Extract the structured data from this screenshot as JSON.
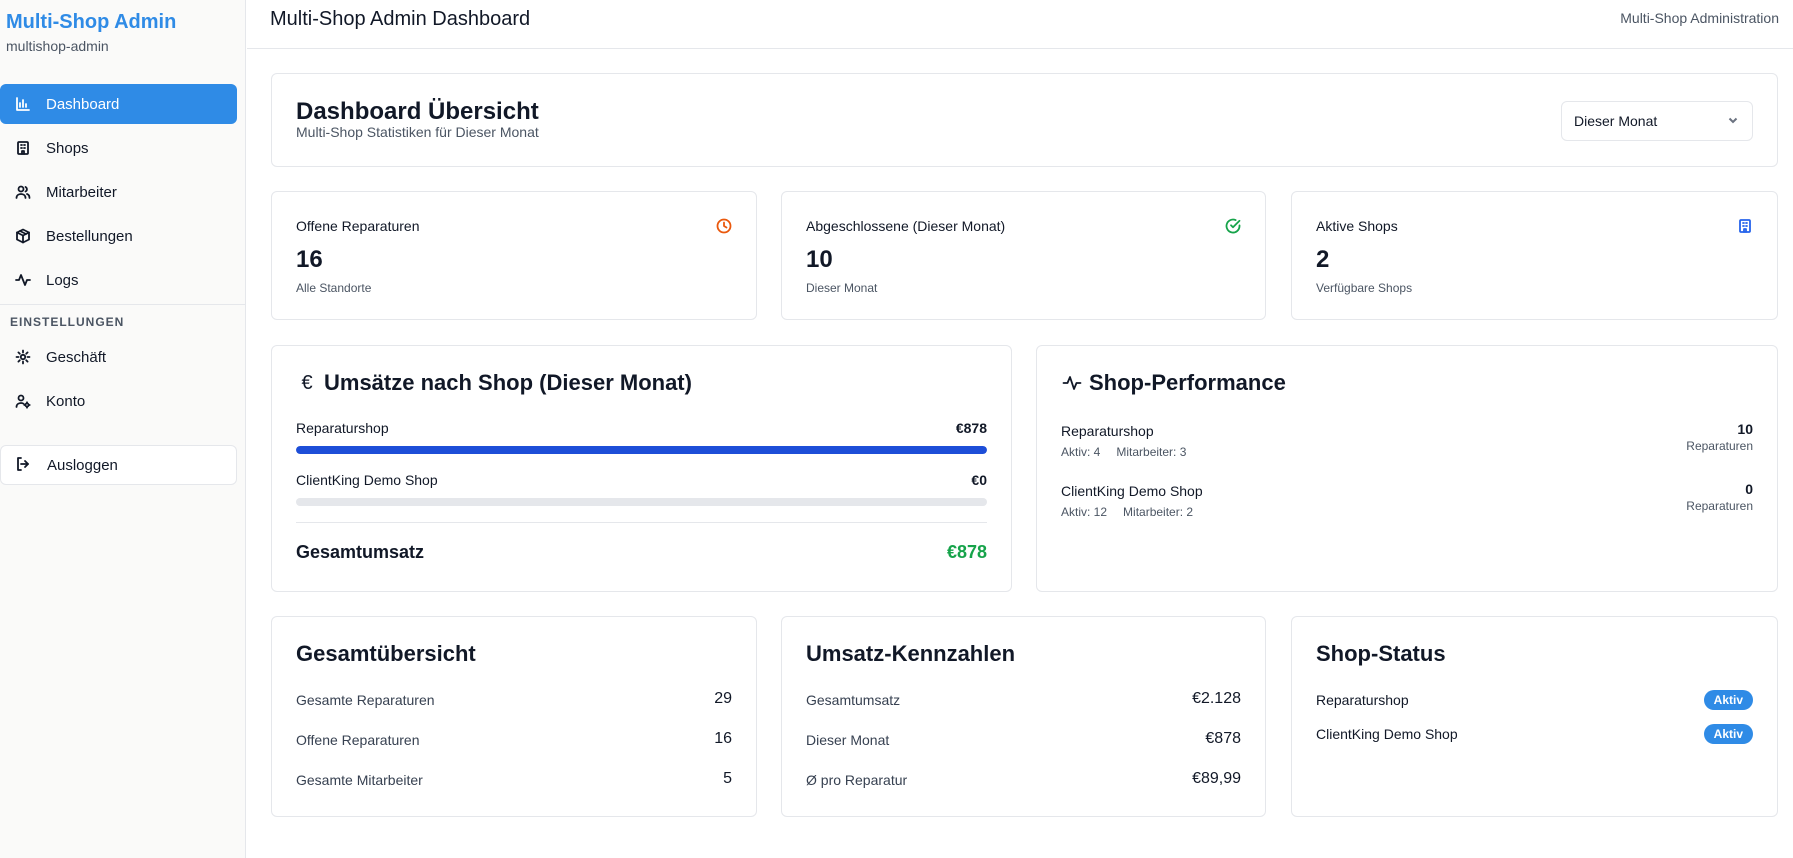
{
  "sidebar": {
    "brand_title": "Multi-Shop Admin",
    "brand_sub": "multishop-admin",
    "items": [
      {
        "label": "Dashboard",
        "icon": "bar-chart-icon"
      },
      {
        "label": "Shops",
        "icon": "building-icon"
      },
      {
        "label": "Mitarbeiter",
        "icon": "users-icon"
      },
      {
        "label": "Bestellungen",
        "icon": "package-icon"
      },
      {
        "label": "Logs",
        "icon": "activity-icon"
      }
    ],
    "section_label": "EINSTELLUNGEN",
    "settings_items": [
      {
        "label": "Geschäft",
        "icon": "gear-icon"
      },
      {
        "label": "Konto",
        "icon": "user-cog-icon"
      }
    ],
    "logout_label": "Ausloggen"
  },
  "header": {
    "title": "Multi-Shop Admin Dashboard",
    "right_text": "Multi-Shop Administration"
  },
  "overview": {
    "title": "Dashboard Übersicht",
    "subtitle": "Multi-Shop Statistiken für Dieser Monat",
    "period_select": "Dieser Monat"
  },
  "stats": [
    {
      "label": "Offene Reparaturen",
      "value": "16",
      "note": "Alle Standorte",
      "icon": "clock-icon",
      "color": "#ea580c"
    },
    {
      "label": "Abgeschlossene (Dieser Monat)",
      "value": "10",
      "note": "Dieser Monat",
      "icon": "check-circle-icon",
      "color": "#16a34a"
    },
    {
      "label": "Aktive Shops",
      "value": "2",
      "note": "Verfügbare Shops",
      "icon": "building-icon",
      "color": "#2563eb"
    }
  ],
  "revenue": {
    "title": "Umsätze nach Shop (Dieser Monat)",
    "icon": "euro-icon",
    "shops": [
      {
        "name": "Reparaturshop",
        "amount": "€878",
        "share": 1.0
      },
      {
        "name": "ClientKing Demo Shop",
        "amount": "€0",
        "share": 0.0
      }
    ],
    "total_label": "Gesamtumsatz",
    "total_value": "€878"
  },
  "performance": {
    "title": "Shop-Performance",
    "icon": "activity-icon",
    "shops": [
      {
        "name": "Reparaturshop",
        "active": "Aktiv: 4",
        "staff": "Mitarbeiter: 3",
        "count": "10",
        "unit": "Reparaturen"
      },
      {
        "name": "ClientKing Demo Shop",
        "active": "Aktiv: 12",
        "staff": "Mitarbeiter: 2",
        "count": "0",
        "unit": "Reparaturen"
      }
    ]
  },
  "totals": {
    "title": "Gesamtübersicht",
    "rows": [
      {
        "label": "Gesamte Reparaturen",
        "value": "29"
      },
      {
        "label": "Offene Reparaturen",
        "value": "16"
      },
      {
        "label": "Gesamte Mitarbeiter",
        "value": "5"
      }
    ]
  },
  "kpis": {
    "title": "Umsatz-Kennzahlen",
    "rows": [
      {
        "label": "Gesamtumsatz",
        "value": "€2.128"
      },
      {
        "label": "Dieser Monat",
        "value": "€878"
      },
      {
        "label": "Ø pro Reparatur",
        "value": "€89,99"
      }
    ]
  },
  "shop_status": {
    "title": "Shop-Status",
    "rows": [
      {
        "name": "Reparaturshop",
        "status": "Aktiv"
      },
      {
        "name": "ClientKing Demo Shop",
        "status": "Aktiv"
      }
    ]
  },
  "colors": {
    "accent": "#2f8be6",
    "progress": "#1d4ed8",
    "success": "#16a34a"
  }
}
